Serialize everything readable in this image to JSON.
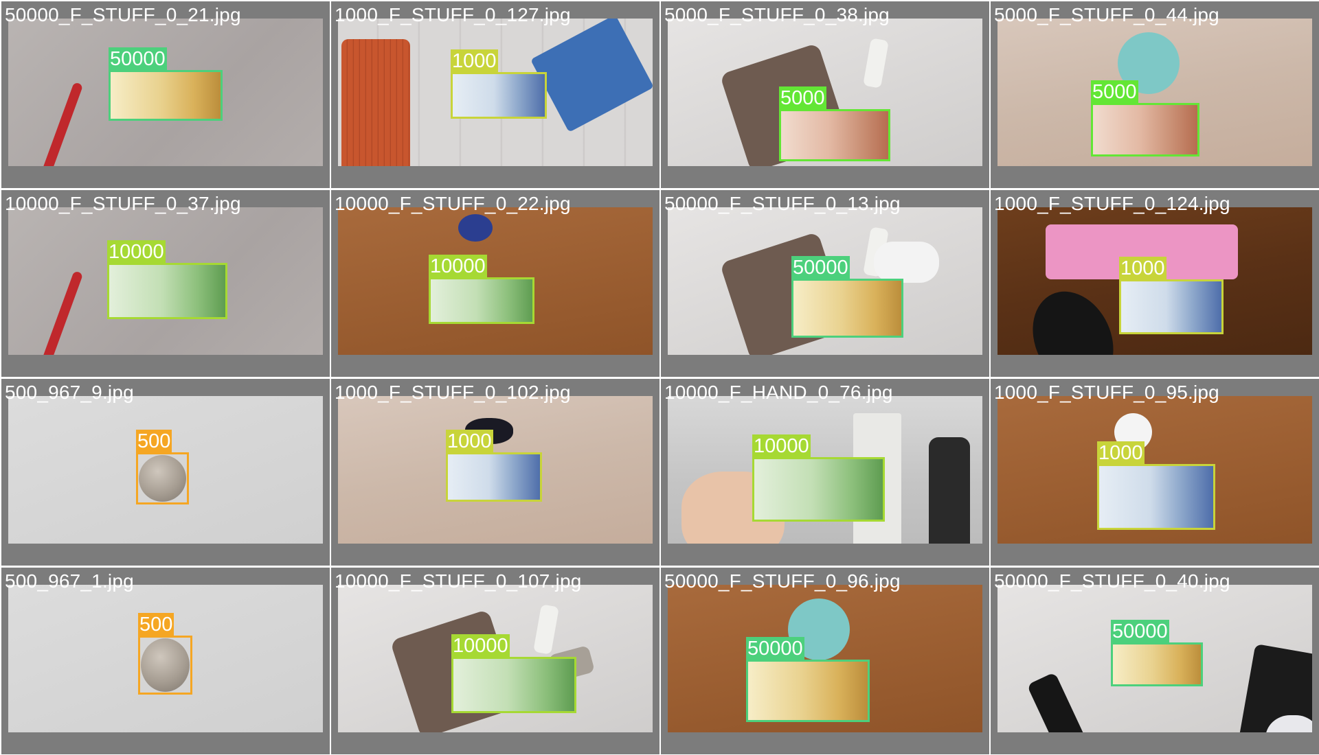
{
  "window": {
    "title": ""
  },
  "classes": {
    "500": {
      "color": "#f5a623"
    },
    "1000": {
      "color": "#c8d43a"
    },
    "5000": {
      "color": "#63e635"
    },
    "10000": {
      "color": "#a6d933"
    },
    "50000": {
      "color": "#4cd07c"
    }
  },
  "tiles": [
    {
      "filename": "50000_F_STUFF_0_21.jpg",
      "background": "plain-gray-surface",
      "objects": [
        "pen"
      ],
      "detections": [
        {
          "label": "50000"
        }
      ]
    },
    {
      "filename": "1000_F_STUFF_0_127.jpg",
      "background": "white-wood-surface",
      "objects": [
        "orange-knit-cloth",
        "snack-pack"
      ],
      "detections": [
        {
          "label": "1000"
        }
      ]
    },
    {
      "filename": "5000_F_STUFF_0_38.jpg",
      "background": "white-table",
      "objects": [
        "patterned-cloth-pouch",
        "glue-stick"
      ],
      "detections": [
        {
          "label": "5000"
        }
      ]
    },
    {
      "filename": "5000_F_STUFF_0_44.jpg",
      "background": "light-wood-surface",
      "objects": [
        "teal-container-lid"
      ],
      "detections": [
        {
          "label": "5000"
        }
      ]
    },
    {
      "filename": "10000_F_STUFF_0_37.jpg",
      "background": "plain-gray-surface",
      "objects": [
        "pen"
      ],
      "detections": [
        {
          "label": "10000"
        }
      ]
    },
    {
      "filename": "10000_F_STUFF_0_22.jpg",
      "background": "brown-wood-table",
      "objects": [
        "cup"
      ],
      "detections": [
        {
          "label": "10000"
        }
      ]
    },
    {
      "filename": "50000_F_STUFF_0_13.jpg",
      "background": "white-table",
      "objects": [
        "patterned-cloth-pouch",
        "glue-stick",
        "soap-dish"
      ],
      "detections": [
        {
          "label": "50000"
        }
      ]
    },
    {
      "filename": "1000_F_STUFF_0_124.jpg",
      "background": "dark-wood-table",
      "objects": [
        "wet-wipes-pack",
        "computer-mouse"
      ],
      "detections": [
        {
          "label": "1000"
        }
      ]
    },
    {
      "filename": "500_967_9.jpg",
      "background": "plain-light-surface",
      "objects": [],
      "detections": [
        {
          "label": "500"
        }
      ]
    },
    {
      "filename": "1000_F_STUFF_0_102.jpg",
      "background": "light-wood-surface",
      "objects": [
        "earbuds-case"
      ],
      "detections": [
        {
          "label": "1000"
        }
      ]
    },
    {
      "filename": "10000_F_HAND_0_76.jpg",
      "background": "room-interior",
      "objects": [
        "hand",
        "refrigerator",
        "person"
      ],
      "detections": [
        {
          "label": "10000"
        }
      ]
    },
    {
      "filename": "1000_F_STUFF_0_95.jpg",
      "background": "brown-wood-table",
      "objects": [
        "magnifier-ring"
      ],
      "detections": [
        {
          "label": "1000"
        }
      ]
    },
    {
      "filename": "500_967_1.jpg",
      "background": "plain-light-surface",
      "objects": [],
      "detections": [
        {
          "label": "500"
        }
      ]
    },
    {
      "filename": "10000_F_STUFF_0_107.jpg",
      "background": "white-table",
      "objects": [
        "patterned-cloth-pouch",
        "glue-stick",
        "eraser"
      ],
      "detections": [
        {
          "label": "10000"
        }
      ]
    },
    {
      "filename": "50000_F_STUFF_0_96.jpg",
      "background": "brown-wood-table",
      "objects": [
        "teal-container-lid"
      ],
      "detections": [
        {
          "label": "50000"
        }
      ]
    },
    {
      "filename": "50000_F_STUFF_0_40.jpg",
      "background": "white-table",
      "objects": [
        "tv-remote",
        "black-tablet",
        "cartoon-toy"
      ],
      "detections": [
        {
          "label": "50000"
        }
      ]
    }
  ]
}
